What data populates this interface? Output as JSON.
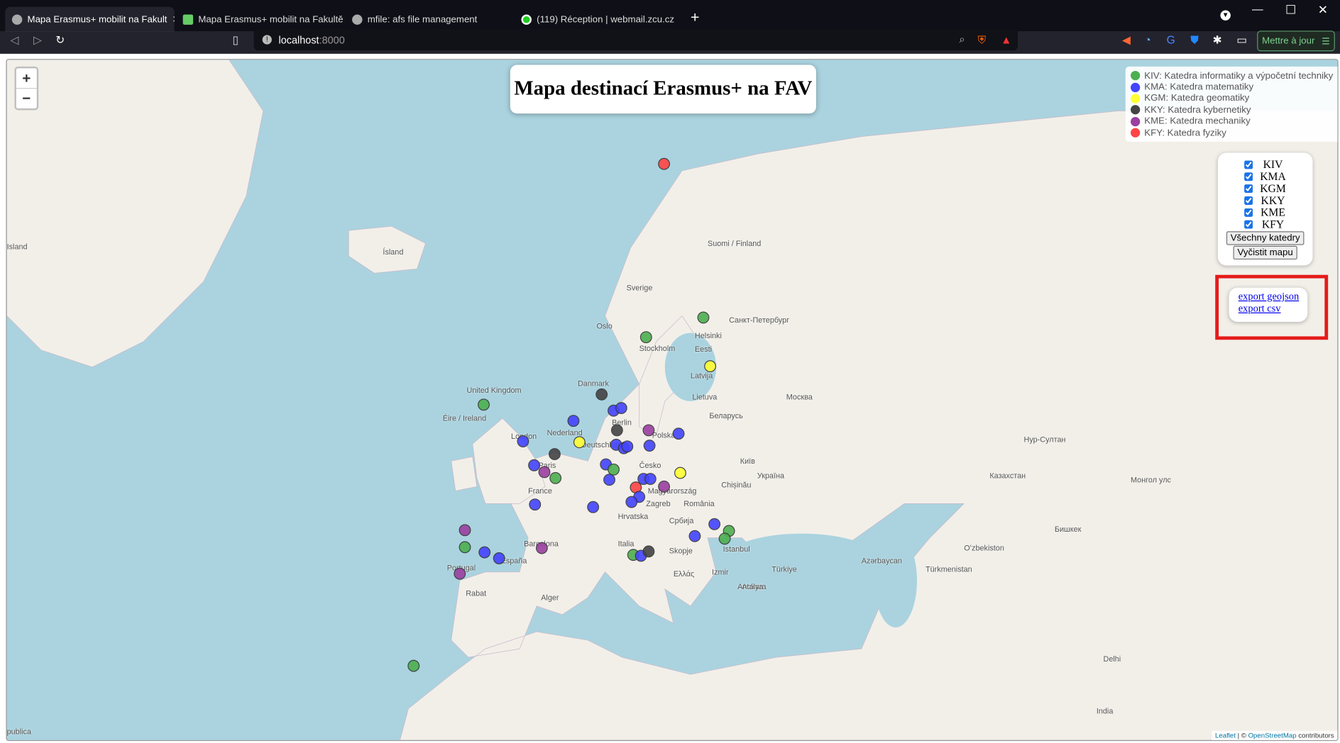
{
  "browser": {
    "tabs": [
      {
        "title": "Mapa Erasmus+ mobilit na Fakult",
        "active": true
      },
      {
        "title": "Mapa Erasmus+ mobilit na Fakultě apl"
      },
      {
        "title": "mfile: afs file management"
      },
      {
        "title": "(119) Réception | webmail.zcu.cz"
      }
    ],
    "new_tab": "+",
    "url_host": "localhost",
    "url_port": ":8000",
    "update_button": "Mettre à jour"
  },
  "map": {
    "title": "Mapa destinací Erasmus+ na FAV",
    "zoom_in": "+",
    "zoom_out": "−",
    "legend": [
      {
        "code": "KIV",
        "label": "KIV: Katedra informatiky a výpočetní techniky",
        "color": "#4caf50"
      },
      {
        "code": "KMA",
        "label": "KMA: Katedra matematiky",
        "color": "#4444ff"
      },
      {
        "code": "KGM",
        "label": "KGM: Katedra geomatiky",
        "color": "#ffff33"
      },
      {
        "code": "KKY",
        "label": "KKY: Katedra kybernetiky",
        "color": "#444444"
      },
      {
        "code": "KME",
        "label": "KME: Katedra mechaniky",
        "color": "#9b3fa0"
      },
      {
        "code": "KFY",
        "label": "KFY: Katedra fyziky",
        "color": "#ff4444"
      }
    ],
    "filters": [
      {
        "label": "KIV",
        "checked": true
      },
      {
        "label": "KMA",
        "checked": true
      },
      {
        "label": "KGM",
        "checked": true
      },
      {
        "label": "KKY",
        "checked": true
      },
      {
        "label": "KME",
        "checked": true
      },
      {
        "label": "KFY",
        "checked": true
      }
    ],
    "all_button": "Všechny katedry",
    "clear_button": "Vyčistit mapu",
    "export_geojson": "export geojson",
    "export_csv": "export csv",
    "attribution_leaflet": "Leaflet",
    "attribution_sep": " | © ",
    "attribution_osm": "OpenStreetMap",
    "attribution_rest": " contributors",
    "labels": [
      "Ísland",
      "Suomi / Finland",
      "Sverige",
      "Oslo",
      "Stockholm",
      "Helsinki",
      "Санкт-Петербург",
      "Eesti",
      "Latvija",
      "Danmark",
      "Lietuva",
      "United Kingdom",
      "Éire / Ireland",
      "London",
      "Nederland",
      "Berlin",
      "Polska",
      "Беларусь",
      "Москва",
      "Deutschland",
      "Česko",
      "France",
      "Paris",
      "Україна",
      "Київ",
      "Chișinău",
      "Magyarország",
      "România",
      "Zagreb",
      "Hrvatska",
      "Србија",
      "Italia",
      "Barcelona",
      "España",
      "Portugal",
      "Istanbul",
      "Türkiye",
      "Ελλάς",
      "Skopje",
      "Ankara",
      "Izmir",
      "Antalya",
      "Rabat",
      "Alger",
      "Казахстан",
      "Нур-Султан",
      "Azərbaycan",
      "Türkmenistan",
      "Oʻzbekiston",
      "Бишкек",
      "India",
      "Delhi",
      "Монгол улс",
      "Island",
      "publica"
    ]
  }
}
